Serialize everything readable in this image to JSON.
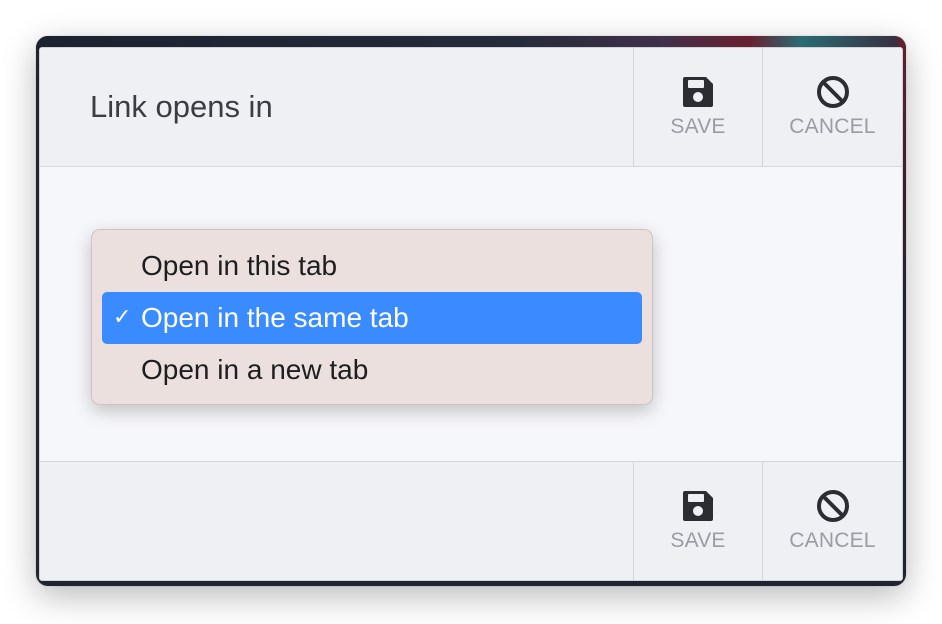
{
  "dialog": {
    "title": "Link opens in",
    "save_label": "SAVE",
    "cancel_label": "CANCEL",
    "icons": {
      "save": "floppy-disk-icon",
      "cancel": "prohibited-circle-icon"
    }
  },
  "menu": {
    "check_mark": "✓",
    "items": [
      {
        "label": "Open in this tab",
        "selected": false
      },
      {
        "label": "Open in the same tab",
        "selected": true
      },
      {
        "label": "Open in a new tab",
        "selected": false
      }
    ]
  },
  "colors": {
    "selection": "#3a8bff",
    "menu_background": "#ebe0de",
    "bar_background": "#eef0f4",
    "muted_text": "#9a9ca3"
  }
}
